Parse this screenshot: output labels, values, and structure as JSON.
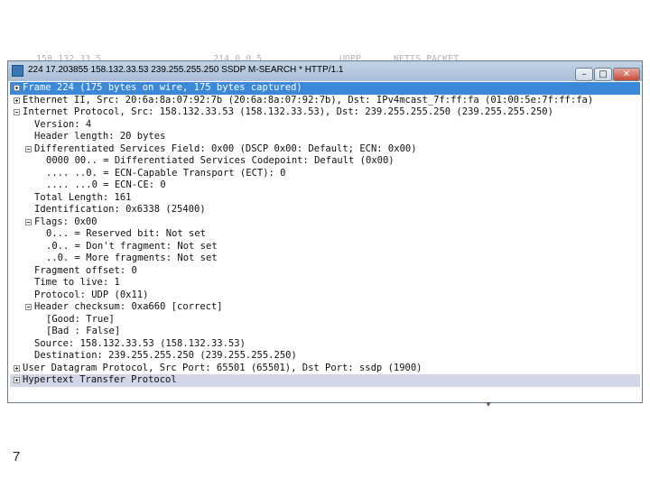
{
  "behind_window": {
    "columns": [
      "158.132.33.5",
      "214.0.0.5",
      "UDPP",
      "NETIS PACKET"
    ]
  },
  "window": {
    "title": "224 17.203855 158.132.33.53 239.255.255.250 SSDP M-SEARCH * HTTP/1.1",
    "icon": "wireshark-app-icon",
    "buttons": {
      "minimize": "–",
      "maximize": "□",
      "close": "✕"
    }
  },
  "tree": {
    "rows": [
      {
        "text": "Frame 224 (175 bytes on wire, 175 bytes captured)",
        "expander": "plus",
        "state": "selected"
      },
      {
        "text": "Ethernet II, Src: 20:6a:8a:07:92:7b (20:6a:8a:07:92:7b), Dst: IPv4mcast_7f:ff:fa (01:00:5e:7f:ff:fa)",
        "expander": "plus",
        "state": ""
      },
      {
        "text": "Internet Protocol, Src: 158.132.33.53 (158.132.33.53), Dst: 239.255.255.250 (239.255.255.250)",
        "expander": "minus",
        "state": ""
      },
      {
        "text": "Version: 4",
        "expander": "",
        "state": ""
      },
      {
        "text": "Header length: 20 bytes",
        "expander": "",
        "state": ""
      },
      {
        "text": "Differentiated Services Field: 0x00 (DSCP 0x00: Default; ECN: 0x00)",
        "expander": "minus",
        "state": ""
      },
      {
        "text": "0000 00.. = Differentiated Services Codepoint: Default (0x00)",
        "expander": "",
        "state": ""
      },
      {
        "text": ".... ..0. = ECN-Capable Transport (ECT): 0",
        "expander": "",
        "state": ""
      },
      {
        "text": ".... ...0 = ECN-CE: 0",
        "expander": "",
        "state": ""
      },
      {
        "text": "Total Length: 161",
        "expander": "",
        "state": ""
      },
      {
        "text": "Identification: 0x6338 (25400)",
        "expander": "",
        "state": ""
      },
      {
        "text": "Flags: 0x00",
        "expander": "minus",
        "state": ""
      },
      {
        "text": "0... = Reserved bit: Not set",
        "expander": "",
        "state": ""
      },
      {
        "text": ".0.. = Don't fragment: Not set",
        "expander": "",
        "state": ""
      },
      {
        "text": "..0. = More fragments: Not set",
        "expander": "",
        "state": ""
      },
      {
        "text": "Fragment offset: 0",
        "expander": "",
        "state": ""
      },
      {
        "text": "Time to live: 1",
        "expander": "",
        "state": ""
      },
      {
        "text": "Protocol: UDP (0x11)",
        "expander": "",
        "state": ""
      },
      {
        "text": "Header checksum: 0xa660 [correct]",
        "expander": "minus",
        "state": ""
      },
      {
        "text": "[Good: True]",
        "expander": "",
        "state": ""
      },
      {
        "text": "[Bad : False]",
        "expander": "",
        "state": ""
      },
      {
        "text": "Source: 158.132.33.53 (158.132.33.53)",
        "expander": "",
        "state": ""
      },
      {
        "text": "Destination: 239.255.255.250 (239.255.255.250)",
        "expander": "",
        "state": ""
      },
      {
        "text": "User Datagram Protocol, Src Port: 65501 (65501), Dst Port: ssdp (1900)",
        "expander": "plus",
        "state": ""
      },
      {
        "text": "Hypertext Transfer Protocol",
        "expander": "plus",
        "state": "highlighted"
      }
    ]
  },
  "page_number": "7"
}
